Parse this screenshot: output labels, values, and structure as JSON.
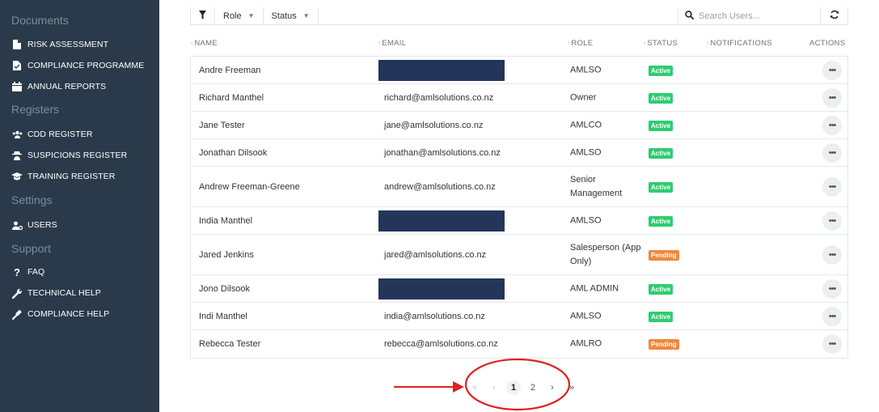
{
  "sidebar": {
    "sections": {
      "documents": "Documents",
      "registers": "Registers",
      "settings": "Settings",
      "support": "Support"
    },
    "items": {
      "risk": "RISK ASSESSMENT",
      "programme": "COMPLIANCE PROGRAMME",
      "reports": "ANNUAL REPORTS",
      "cdd": "CDD REGISTER",
      "suspicions": "SUSPICIONS REGISTER",
      "training": "TRAINING REGISTER",
      "users": "USERS",
      "faq": "FAQ",
      "tech_help": "TECHNICAL HELP",
      "compliance_help": "COMPLIANCE HELP"
    }
  },
  "toolbar": {
    "role_label": "Role",
    "status_label": "Status",
    "search_placeholder": "Search Users..."
  },
  "columns": {
    "name": "NAME",
    "email": "EMAIL",
    "role": "ROLE",
    "status": "STATUS",
    "notifications": "NOTIFICATIONS",
    "actions": "ACTIONS"
  },
  "rows": [
    {
      "name": "Andre Freeman",
      "email": "",
      "role": "AMLSO",
      "status": "Active"
    },
    {
      "name": "Richard Manthel",
      "email": "richard@amlsolutions.co.nz",
      "role": "Owner",
      "status": "Active"
    },
    {
      "name": "Jane Tester",
      "email": "jane@amlsolutions.co.nz",
      "role": "AMLCO",
      "status": "Active"
    },
    {
      "name": "Jonathan Dilsook",
      "email": "jonathan@amlsolutions.co.nz",
      "role": "AMLSO",
      "status": "Active"
    },
    {
      "name": "Andrew Freeman-Greene",
      "email": "andrew@amlsolutions.co.nz",
      "role": "Senior Management",
      "status": "Active"
    },
    {
      "name": "India Manthel",
      "email": "",
      "role": "AMLSO",
      "status": "Active"
    },
    {
      "name": "Jared Jenkins",
      "email": "jared@amlsolutions.co.nz",
      "role": "Salesperson (App Only)",
      "status": "Pending"
    },
    {
      "name": "Jono Dilsook",
      "email": "",
      "role": "AML ADMIN",
      "status": "Active"
    },
    {
      "name": "Indi Manthel",
      "email": "india@amlsolutions.co.nz",
      "role": "AMLSO",
      "status": "Active"
    },
    {
      "name": "Rebecca Tester",
      "email": "rebecca@amlsolutions.co.nz",
      "role": "AMLRO",
      "status": "Pending"
    }
  ],
  "pagination": {
    "first": "«",
    "prev": "‹",
    "page1": "1",
    "page2": "2",
    "next": "›",
    "last": "»"
  },
  "icons": {
    "risk": "document-icon",
    "programme": "document-check-icon",
    "reports": "calendar-icon",
    "cdd": "users-group-icon",
    "suspicions": "spy-icon",
    "training": "graduation-cap-icon",
    "users": "user-settings-icon",
    "faq": "question-icon",
    "tech_help": "wrench-icon",
    "compliance_help": "gavel-icon",
    "search": "search-icon",
    "refresh": "refresh-icon",
    "filter": "filter-icon",
    "more": "more-icon"
  },
  "colors": {
    "sidebar_bg": "#2b3a4a",
    "active": "#2ecc71",
    "pending": "#f0883e",
    "redaction": "#23365a",
    "annotation": "#e02020"
  }
}
